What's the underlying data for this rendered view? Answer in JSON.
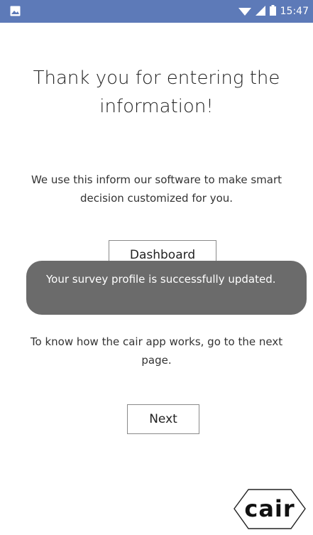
{
  "status_bar": {
    "time": "15:47",
    "icons": [
      "image-icon",
      "wifi-icon",
      "signal-icon",
      "battery-icon"
    ],
    "color": "#5d7ab8"
  },
  "title": "Thank you for entering the information!",
  "description": "We use this inform our software to make smart decision customized for you.",
  "dashboard_button": "Dashboard",
  "toast": "Your survey profile is successfully updated.",
  "info_text": "To know how the cair app works, go to the next page.",
  "next_button": "Next",
  "logo": "cair"
}
